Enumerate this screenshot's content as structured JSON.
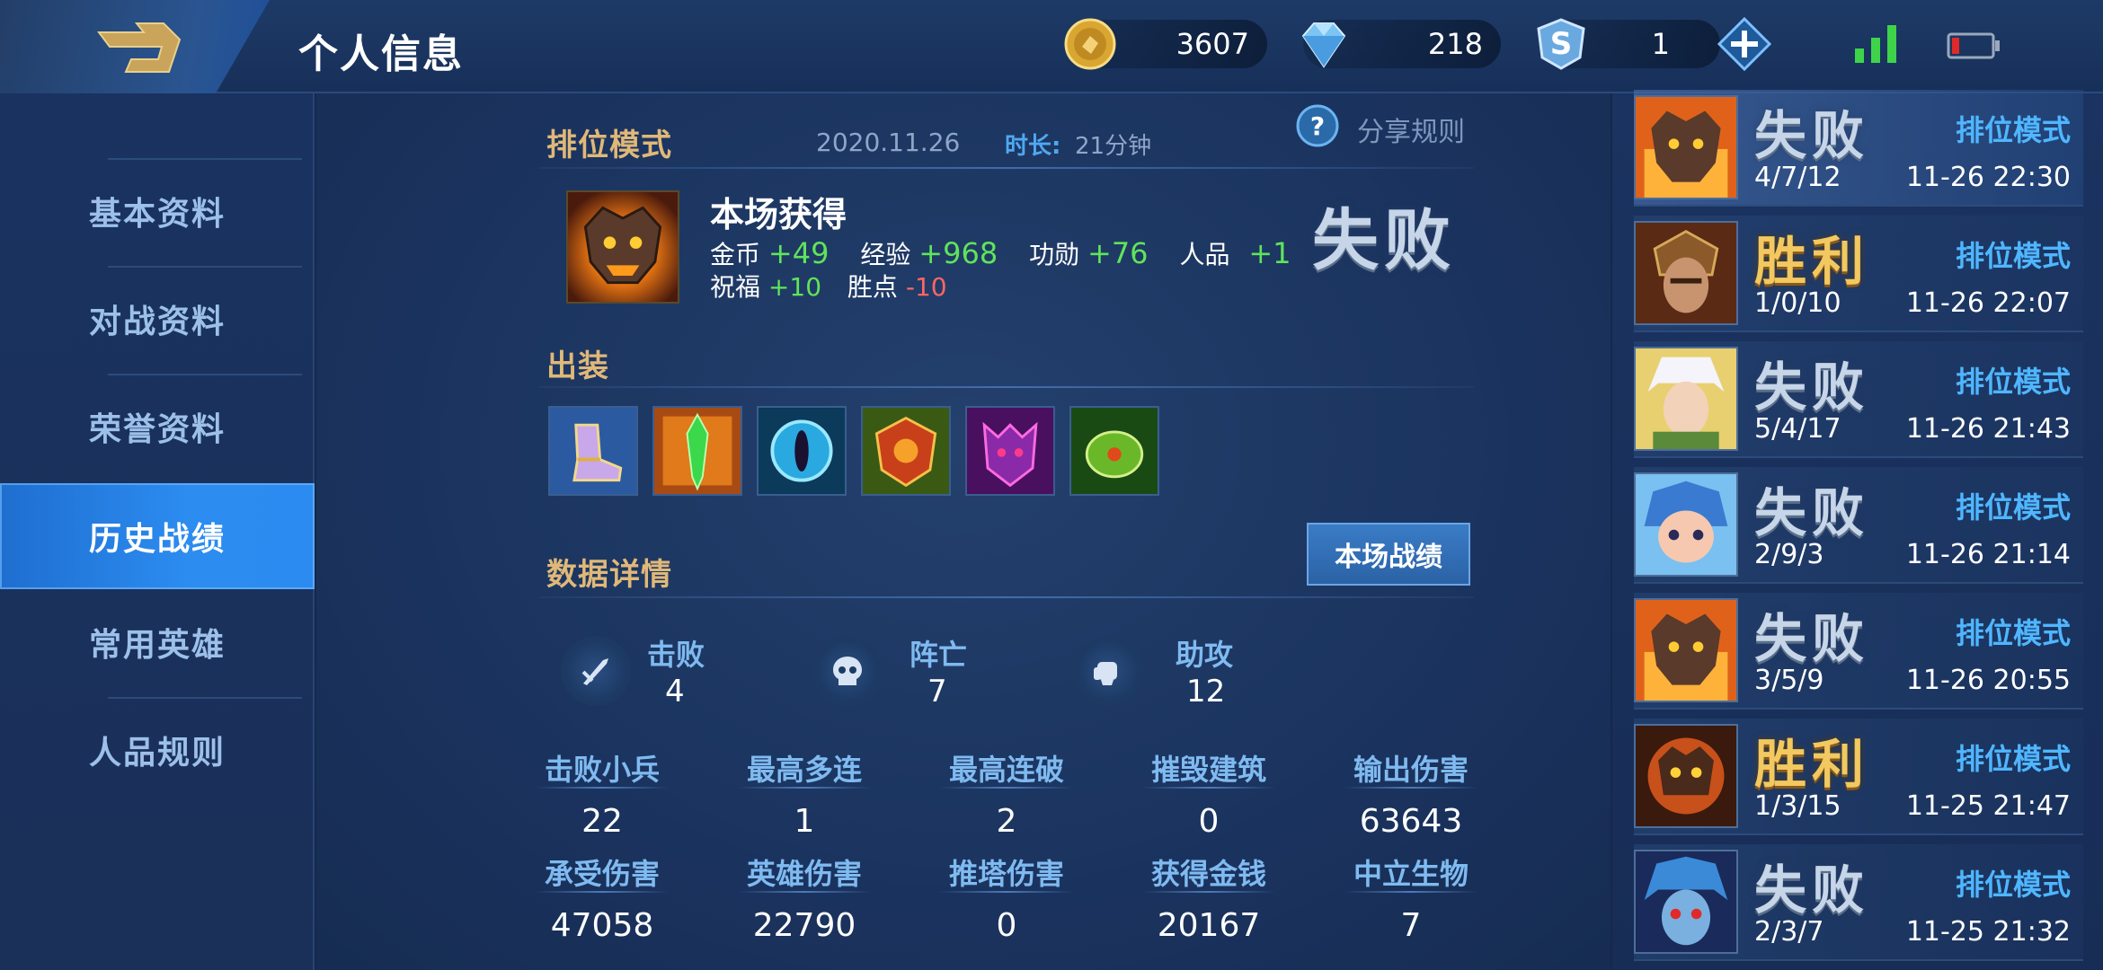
{
  "header": {
    "title": "个人信息",
    "gold": "3607",
    "diamonds": "218",
    "vouchers": "1"
  },
  "sidebar": {
    "items": [
      {
        "label": "基本资料"
      },
      {
        "label": "对战资料"
      },
      {
        "label": "荣誉资料"
      },
      {
        "label": "历史战绩"
      },
      {
        "label": "常用英雄"
      },
      {
        "label": "人品规则"
      }
    ],
    "active_index": 3
  },
  "match": {
    "mode": "排位模式",
    "date": "2020.11.26",
    "duration_label": "时长:",
    "duration": "21分钟",
    "share_rule": "分享规则",
    "result": "失败",
    "rewards_title": "本场获得",
    "rewards": {
      "gold_label": "金币",
      "gold": "+49",
      "exp_label": "经验",
      "exp": "+968",
      "merit_label": "功勋",
      "merit": "+76",
      "character_label": "人品",
      "character": "+1",
      "blessing_label": "祝福",
      "blessing": "+10",
      "winpoint_label": "胜点",
      "winpoint": "-10"
    },
    "build_title": "出装",
    "details_title": "数据详情",
    "detail_button": "本场战绩",
    "kda": {
      "kills_label": "击败",
      "kills": "4",
      "deaths_label": "阵亡",
      "deaths": "7",
      "assists_label": "助攻",
      "assists": "12"
    },
    "stats": [
      {
        "label": "击败小兵",
        "value": "22"
      },
      {
        "label": "最高多连",
        "value": "1"
      },
      {
        "label": "最高连破",
        "value": "2"
      },
      {
        "label": "摧毁建筑",
        "value": "0"
      },
      {
        "label": "输出伤害",
        "value": "63643"
      },
      {
        "label": "承受伤害",
        "value": "47058"
      },
      {
        "label": "英雄伤害",
        "value": "22790"
      },
      {
        "label": "推塔伤害",
        "value": "0"
      },
      {
        "label": "获得金钱",
        "value": "20167"
      },
      {
        "label": "中立生物",
        "value": "7"
      }
    ]
  },
  "history": [
    {
      "result": "失败",
      "mode": "排位模式",
      "kda": "4/7/12",
      "time": "11-26 22:30",
      "win": false
    },
    {
      "result": "胜利",
      "mode": "排位模式",
      "kda": "1/0/10",
      "time": "11-26 22:07",
      "win": true
    },
    {
      "result": "失败",
      "mode": "排位模式",
      "kda": "5/4/17",
      "time": "11-26 21:43",
      "win": false
    },
    {
      "result": "失败",
      "mode": "排位模式",
      "kda": "2/9/3",
      "time": "11-26 21:14",
      "win": false
    },
    {
      "result": "失败",
      "mode": "排位模式",
      "kda": "3/5/9",
      "time": "11-26 20:55",
      "win": false
    },
    {
      "result": "胜利",
      "mode": "排位模式",
      "kda": "1/3/15",
      "time": "11-25 21:47",
      "win": true
    },
    {
      "result": "失败",
      "mode": "排位模式",
      "kda": "2/3/7",
      "time": "11-25 21:32",
      "win": false
    }
  ],
  "colors": {
    "accent_blue": "#2c8cf0",
    "gold_text": "#e0b878",
    "positive": "#5fe45a",
    "negative": "#ff6565",
    "mode_blue": "#4fb6ff"
  },
  "icons": {
    "back": "back-arrow-icon",
    "gold": "gold-coin-icon",
    "diamond": "diamond-icon",
    "voucher": "voucher-s-icon",
    "plus": "plus-icon",
    "signal": "signal-icon",
    "battery": "battery-icon",
    "help": "question-icon",
    "kills": "sword-icon",
    "deaths": "skull-icon",
    "assists": "fist-icon"
  }
}
